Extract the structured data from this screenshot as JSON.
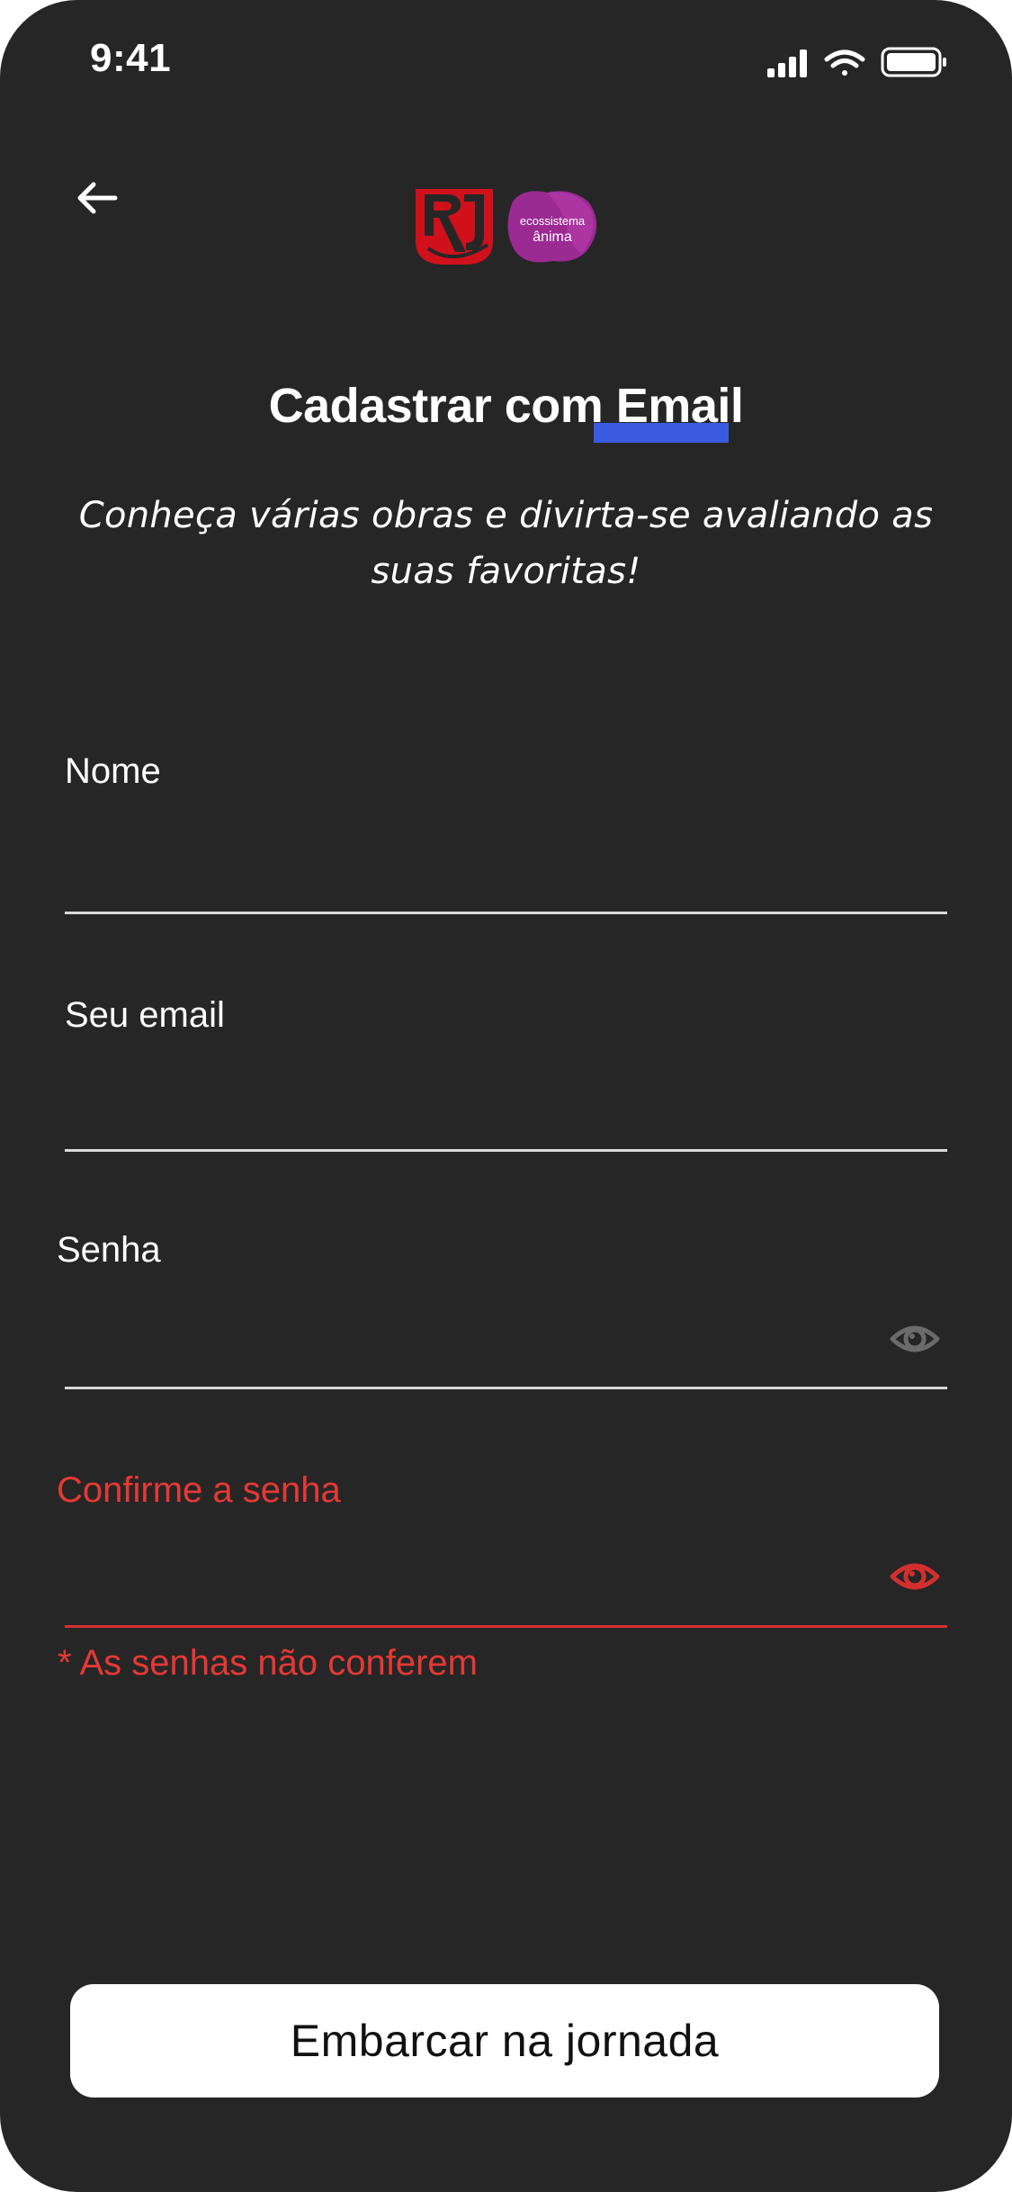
{
  "status_bar": {
    "time": "9:41",
    "icons": [
      "signal-icon",
      "wifi-icon",
      "battery-icon"
    ]
  },
  "header": {
    "back_icon": "arrow-left-icon",
    "logo_badge_line1": "ecossistema",
    "logo_badge_line2": "ânima"
  },
  "title": "Cadastrar com Email",
  "subtitle": "Conheça várias obras e divirta-se avaliando as suas favoritas!",
  "form": {
    "name_label": "Nome",
    "name_value": "",
    "email_label": "Seu email",
    "email_value": "",
    "password_label": "Senha",
    "password_value": "",
    "confirm_label": "Confirme a senha",
    "confirm_value": "",
    "error_message": "* As senhas não conferem"
  },
  "submit_label": "Embarcar na jornada",
  "colors": {
    "background": "#262627",
    "accent_underline": "#3a5be0",
    "error": "#e53935",
    "logo_red": "#d0101b",
    "badge_purple": "#9b2a93"
  }
}
